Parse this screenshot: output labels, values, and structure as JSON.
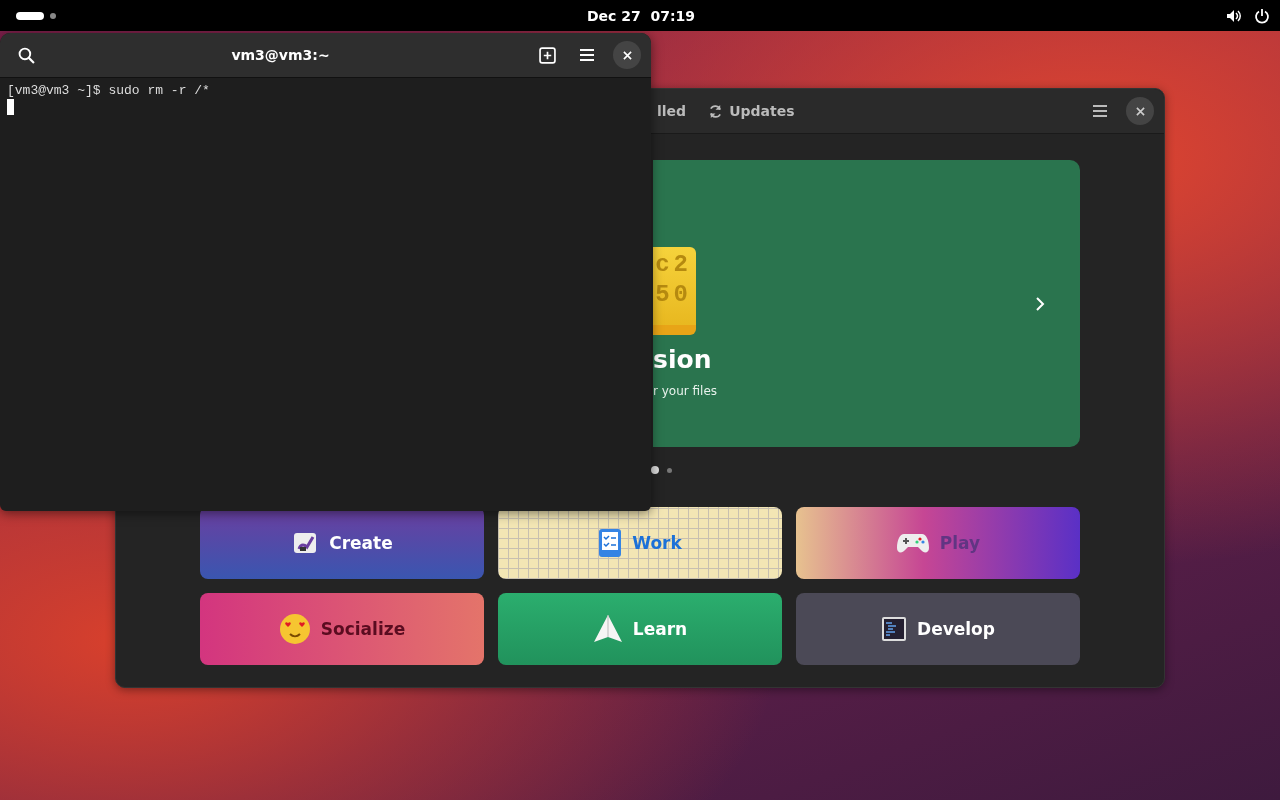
{
  "top_bar": {
    "clock": "Dec 27  07:19"
  },
  "terminal": {
    "title": "vm3@vm3:~",
    "lines": [
      "[vm3@vm3 ~]$ sudo rm -r /*"
    ]
  },
  "software": {
    "tabs": [
      {
        "label": "lled",
        "kind": "plain",
        "selected": false
      },
      {
        "label": "Updates",
        "kind": "updates",
        "selected": false
      }
    ],
    "banner": {
      "title": "sion",
      "subtitle": "r your files",
      "icon_lines": [
        "c2",
        "50"
      ]
    },
    "carousel_dots": [
      {
        "selected": true
      },
      {
        "selected": false
      }
    ],
    "categories": [
      {
        "label": "Create",
        "kind": "create"
      },
      {
        "label": "Work",
        "kind": "work"
      },
      {
        "label": "Play",
        "kind": "play"
      },
      {
        "label": "Socialize",
        "kind": "socialize"
      },
      {
        "label": "Learn",
        "kind": "learn"
      },
      {
        "label": "Develop",
        "kind": "develop"
      }
    ]
  }
}
